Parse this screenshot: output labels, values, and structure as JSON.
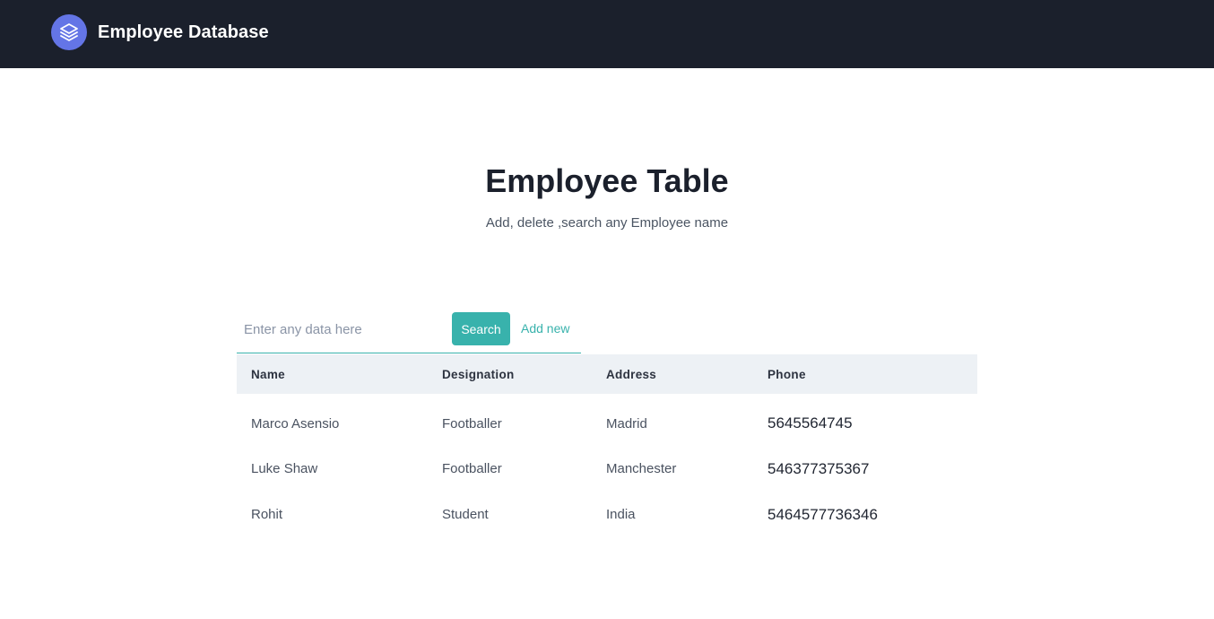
{
  "navbar": {
    "brand_name": "Employee Database",
    "logo_icon": "layers-icon",
    "colors": {
      "background": "#1b202c",
      "logo": "#6475e6"
    }
  },
  "hero": {
    "title": "Employee Table",
    "subtitle": "Add, delete ,search any Employee name"
  },
  "search": {
    "placeholder": "Enter any data here",
    "value": "",
    "search_label": "Search",
    "add_new_label": "Add new",
    "accent_color": "#38b2ac"
  },
  "table": {
    "columns": [
      "Name",
      "Designation",
      "Address",
      "Phone"
    ],
    "rows": [
      {
        "name": "Marco Asensio",
        "designation": "Footballer",
        "address": "Madrid",
        "phone": "5645564745"
      },
      {
        "name": "Luke Shaw",
        "designation": "Footballer",
        "address": "Manchester",
        "phone": "546377375367"
      },
      {
        "name": "Rohit",
        "designation": "Student",
        "address": "India",
        "phone": "5464577736346"
      }
    ]
  }
}
